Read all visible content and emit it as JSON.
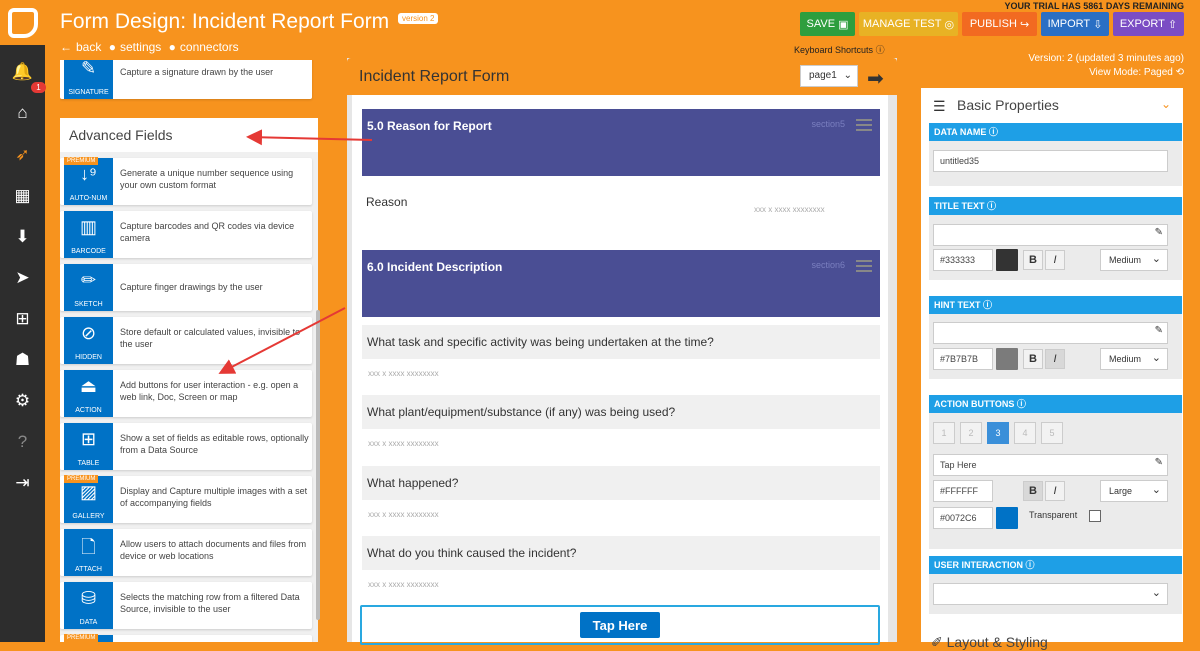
{
  "header": {
    "title": "Form Design: Incident Report Form",
    "version_badge": "version 2",
    "crumbs": [
      "back",
      "settings",
      "connectors"
    ],
    "trial": "YOUR TRIAL HAS 5861 DAYS REMAINING",
    "keyboard": "Keyboard Shortcuts",
    "version_info": "Version: 2 (updated 3 minutes ago)",
    "view_mode": "View Mode: Paged",
    "buttons": {
      "save": "SAVE",
      "manage_test": "MANAGE TEST",
      "publish": "PUBLISH",
      "import": "IMPORT",
      "export": "EXPORT"
    }
  },
  "nav": {
    "badge": "1"
  },
  "left": {
    "signature": {
      "label": "SIGNATURE",
      "desc": "Capture a signature drawn by the user"
    },
    "section_title": "Advanced Fields",
    "premium": "PREMIUM",
    "items": [
      {
        "label": "AUTO-NUM",
        "desc": "Generate a unique number sequence using your own custom format"
      },
      {
        "label": "BARCODE",
        "desc": "Capture barcodes and QR codes via device camera"
      },
      {
        "label": "SKETCH",
        "desc": "Capture finger drawings by the user"
      },
      {
        "label": "HIDDEN",
        "desc": "Store default or calculated values, invisible to the user"
      },
      {
        "label": "ACTION",
        "desc": "Add buttons for user interaction - e.g. open a web link, Doc, Screen or map"
      },
      {
        "label": "TABLE",
        "desc": "Show a set of fields as editable rows, optionally from a Data Source"
      },
      {
        "label": "GALLERY",
        "desc": "Display and Capture multiple images with a set of accompanying fields"
      },
      {
        "label": "ATTACH",
        "desc": "Allow users to attach documents and files from device or web locations"
      },
      {
        "label": "DATA",
        "desc": "Selects the matching row from a filtered Data Source, invisible to the user"
      }
    ]
  },
  "form": {
    "title": "Incident Report Form",
    "page": "page1",
    "section5": {
      "name": "5.0 Reason for Report",
      "id": "section5"
    },
    "reason_label": "Reason",
    "placeholder": "xxx x xxxx xxxxxxxx",
    "section6": {
      "name": "6.0 Incident Description",
      "id": "section6"
    },
    "questions": [
      "What task and specific activity was being undertaken at the time?",
      "What plant/equipment/substance (if any) was being used?",
      "What happened?",
      "What do you think caused the incident?"
    ],
    "tap_button": "Tap Here"
  },
  "props": {
    "title": "Basic Properties",
    "data_name_label": "DATA NAME",
    "data_name_value": "untitled35",
    "title_text_label": "TITLE TEXT",
    "title_color": "#333333",
    "title_size": "Medium",
    "hint_text_label": "HINT TEXT",
    "hint_color": "#7B7B7B",
    "hint_size": "Medium",
    "action_buttons_label": "ACTION BUTTONS",
    "pages": [
      "1",
      "2",
      "3",
      "4",
      "5"
    ],
    "button_text": "Tap Here",
    "text_color": "#FFFFFF",
    "text_size": "Large",
    "bg_color": "#0072C6",
    "transparent_label": "Transparent",
    "user_interaction_label": "USER INTERACTION",
    "bold": "B",
    "italic": "I",
    "layout_label": "Layout & Styling"
  },
  "colors": {
    "accent": "#f7931e",
    "section": "#4a4e94",
    "blue": "#0072c6",
    "bar": "#1e9fe6"
  }
}
